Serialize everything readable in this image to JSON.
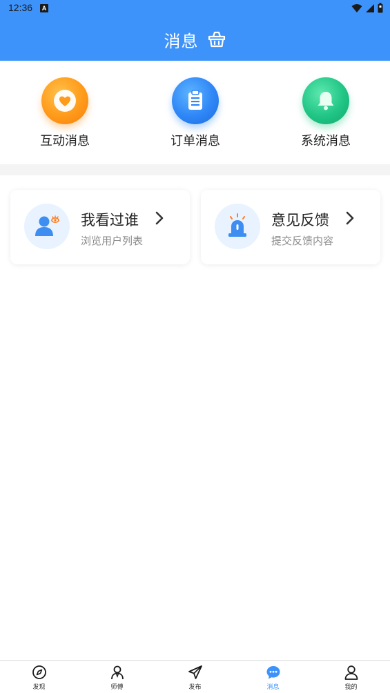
{
  "status_bar": {
    "time": "12:36",
    "badge": "A"
  },
  "header": {
    "title": "消息",
    "bg_color": "#3d93fa"
  },
  "quick_items": [
    {
      "label": "互动消息",
      "icon": "heart-icon",
      "color": "#ff9d1f"
    },
    {
      "label": "订单消息",
      "icon": "clipboard-icon",
      "color": "#2f86f6"
    },
    {
      "label": "系统消息",
      "icon": "bell-icon",
      "color": "#20c585"
    }
  ],
  "cards": [
    {
      "title": "我看过谁",
      "subtitle": "浏览用户列表",
      "icon": "user-eye-icon"
    },
    {
      "title": "意见反馈",
      "subtitle": "提交反馈内容",
      "icon": "alarm-light-icon"
    }
  ],
  "bottom_nav": [
    {
      "label": "发现",
      "icon": "compass-icon",
      "active": false
    },
    {
      "label": "师傅",
      "icon": "worker-icon",
      "active": false
    },
    {
      "label": "发布",
      "icon": "paper-plane-icon",
      "active": false
    },
    {
      "label": "消息",
      "icon": "chat-bubble-icon",
      "active": true
    },
    {
      "label": "我的",
      "icon": "person-icon",
      "active": false
    }
  ],
  "colors": {
    "accent": "#3d93fa",
    "muted_text": "#8a8a8a",
    "card_icon_bg": "#e8f3ff"
  }
}
